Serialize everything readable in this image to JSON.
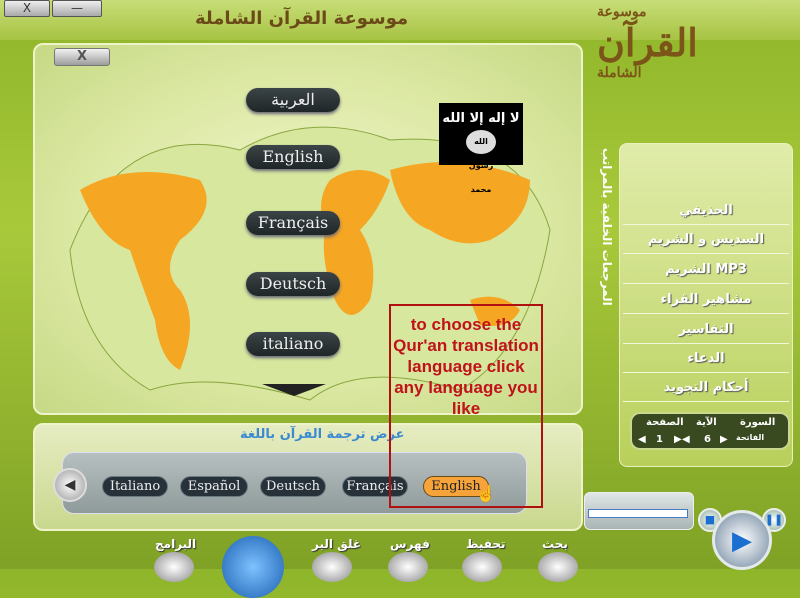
{
  "window": {
    "title": "موسوعة القرآن الشاملة",
    "close_label": "X",
    "minimize_label": "—"
  },
  "logo": {
    "line1": "موسوعة",
    "line2": "القرآن",
    "line3": "الشاملة"
  },
  "main": {
    "close_label": "X",
    "languages": [
      "العربية",
      "English",
      "Français",
      "Deutsch",
      "italiano"
    ],
    "flag": {
      "line1": "لا إله إلا الله",
      "seal": "الله رسول محمد"
    }
  },
  "annotation": {
    "text": "to choose the Qur'an translation language click any language you like",
    "color": "#c0121a"
  },
  "translation": {
    "title": "عرض ترجمة القرآن باللغة",
    "languages": [
      {
        "label": "Italiano",
        "active": false
      },
      {
        "label": "Español",
        "active": false
      },
      {
        "label": "Deutsch",
        "active": false
      },
      {
        "label": "Français",
        "active": false
      },
      {
        "label": "English",
        "active": true
      }
    ]
  },
  "sidebar": {
    "title": "المرجعات الخلفية بالمراتب",
    "items": [
      "الحذيفي",
      "السديس و الشريم",
      "الشريم MP3",
      "مشاهير القراء",
      "التفاسير",
      "الدعاء",
      "أحكام التجويد"
    ],
    "nav": {
      "surah_label": "السورة",
      "surah_value": "الفاتحة",
      "ayah_label": "الآية",
      "ayah_value": "6",
      "page_label": "الصفحة",
      "page_value": "1"
    }
  },
  "toolbar": {
    "items": [
      "البرامج",
      "غلق البر",
      "فهرس",
      "تحفيظ",
      "بحث"
    ]
  },
  "colors": {
    "accent": "#f6a43a",
    "panel_green": "#a8c93a"
  }
}
